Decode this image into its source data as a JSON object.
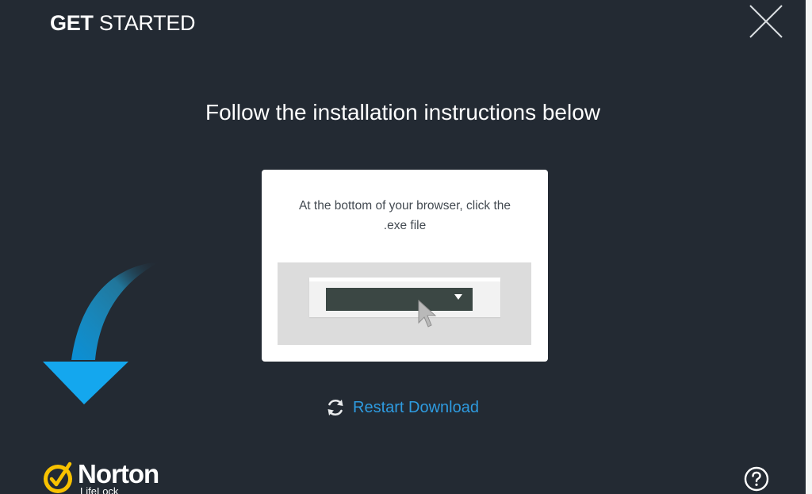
{
  "header": {
    "title_bold": "GET",
    "title_light": "STARTED",
    "close_icon": "close-icon"
  },
  "main": {
    "headline": "Follow the installation instructions below",
    "instruction": {
      "line1": "At the bottom of your browser, click the",
      "line2": ".exe file"
    },
    "illustration": {
      "icons": [
        "dropdown-arrow-icon",
        "mouse-pointer-icon"
      ]
    },
    "restart": {
      "label": "Restart Download",
      "icon": "refresh-icon"
    },
    "download_arrow_icon": "download-arrow-icon"
  },
  "footer": {
    "logo_text": "Norton",
    "logo_sub": "LifeLock",
    "logo_icon": "norton-checkmark-icon",
    "help_icon": "help-icon"
  },
  "colors": {
    "background": "#232a33",
    "link": "#2e9be0",
    "arrow_light": "#1fb4f0",
    "arrow_dark": "#0a8fd6",
    "logo_yellow": "#f8c200"
  }
}
